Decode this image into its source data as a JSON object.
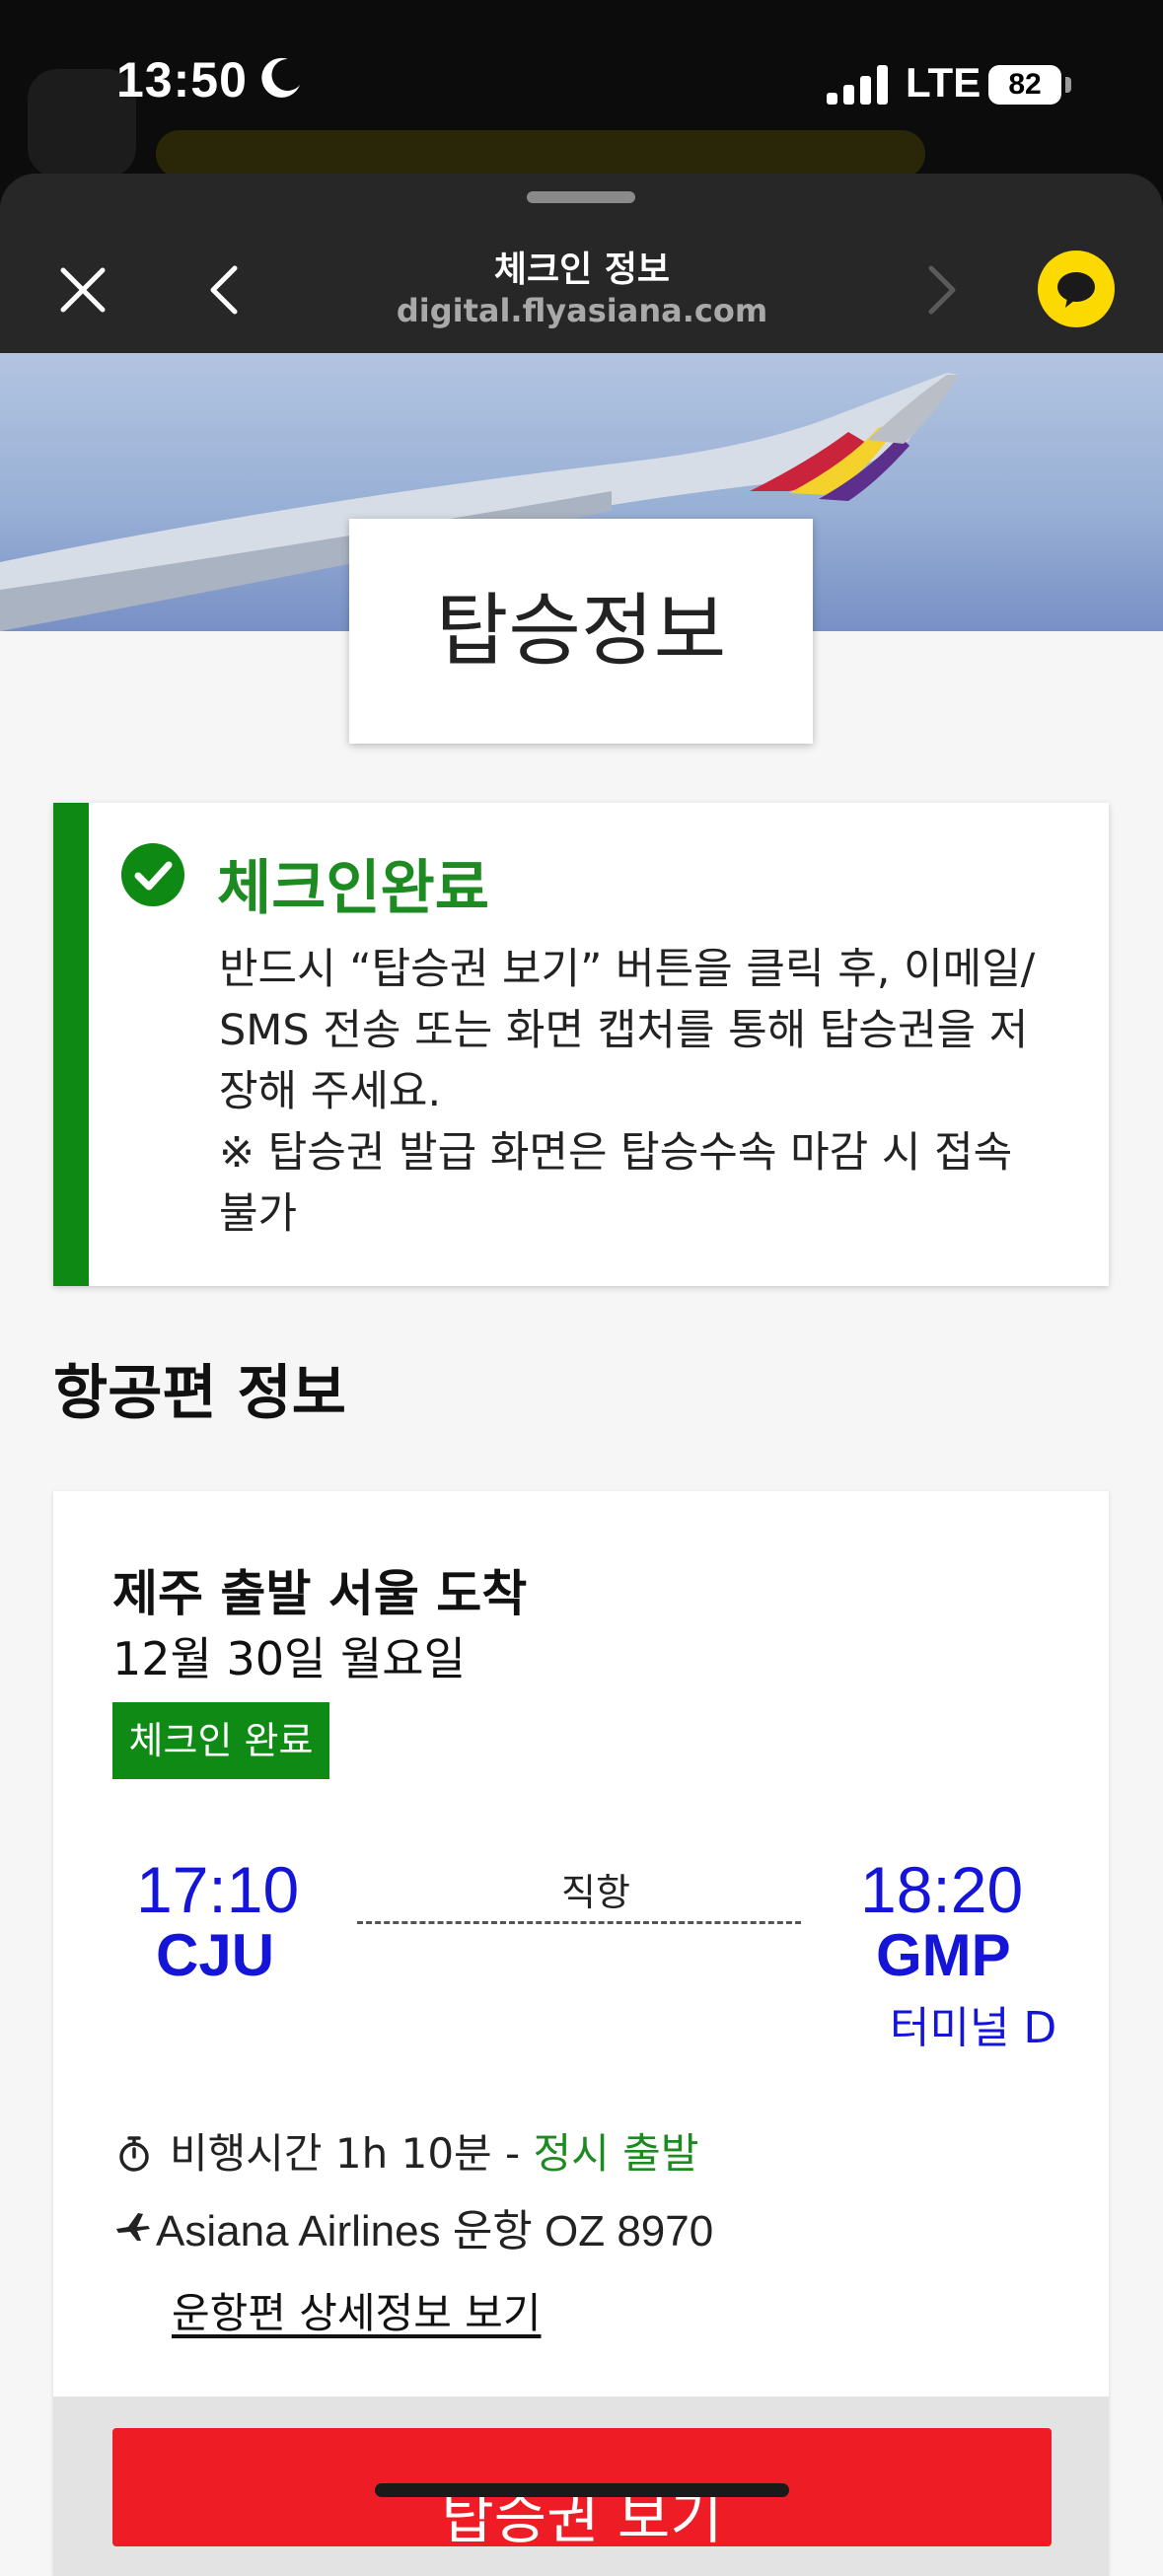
{
  "status_bar": {
    "time": "13:50",
    "network": "LTE",
    "battery": "82"
  },
  "header": {
    "title": "체크인 정보",
    "url": "digital.flyasiana.com"
  },
  "hero": {
    "title": "탑승정보"
  },
  "notice": {
    "title": "체크인완료",
    "lines": [
      "반드시 “탑승권 보기” 버튼을 클릭 후, 이메일/",
      "SMS 전송 또는 화면 캡처를 통해 탑승권을 저",
      "장해 주세요.",
      "※ 탑승권 발급 화면은 탑승수속 마감 시 접속",
      "불가"
    ]
  },
  "section": {
    "title": "항공편 정보"
  },
  "flight": {
    "route": "제주 출발 서울 도착",
    "date": "12월 30일 월요일",
    "status": "체크인 완료",
    "departure": {
      "time": "17:10",
      "code": "CJU"
    },
    "arrival": {
      "time": "18:20",
      "code": "GMP",
      "terminal": "터미널 D"
    },
    "route_type": "직항",
    "duration_label": "비행시간 1h 10분",
    "duration_sep": " - ",
    "ontime": "정시 출발",
    "operator": "Asiana Airlines 운항  OZ 8970",
    "details_link": "운항편 상세정보 보기"
  },
  "boarding_pass": {
    "label": "탑승권 보기"
  },
  "colors": {
    "brand_red": "#ee1c25",
    "success_green": "#0e8a14",
    "time_blue": "#1515d8",
    "kakao_yellow": "#fcd900"
  }
}
